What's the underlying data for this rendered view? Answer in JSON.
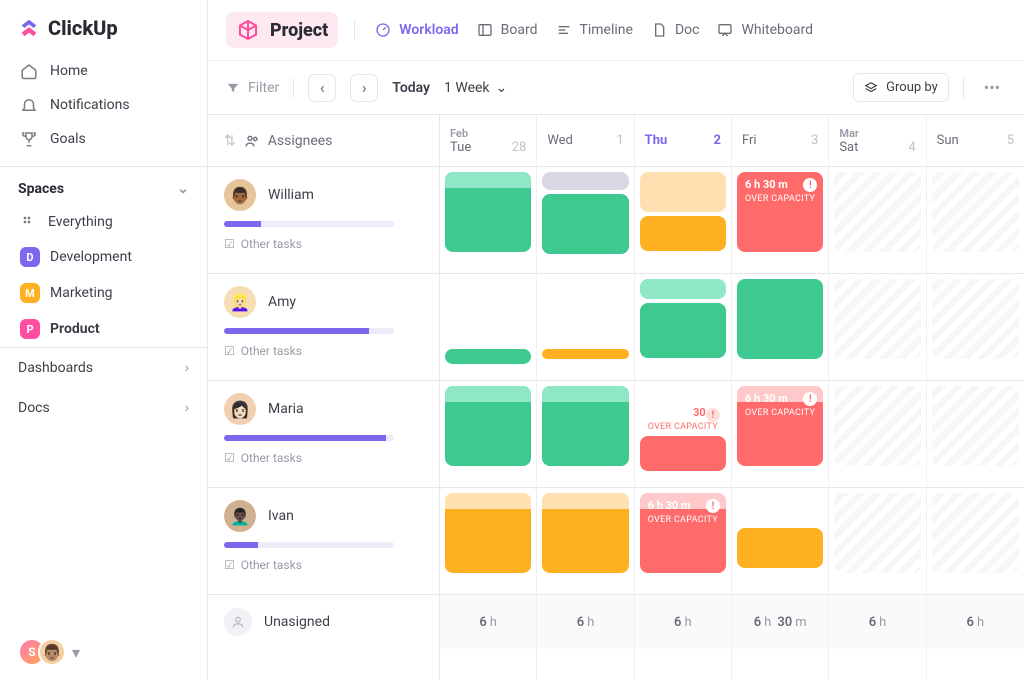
{
  "brand": "ClickUp",
  "nav": {
    "home": "Home",
    "notifications": "Notifications",
    "goals": "Goals"
  },
  "sidebar": {
    "spaces_label": "Spaces",
    "everything": "Everything",
    "items": [
      {
        "letter": "D",
        "label": "Development",
        "color": "#7b68ee"
      },
      {
        "letter": "M",
        "label": "Marketing",
        "color": "#ffb020"
      },
      {
        "letter": "P",
        "label": "Product",
        "color": "#ff4ea0"
      }
    ],
    "dashboards": "Dashboards",
    "docs": "Docs"
  },
  "header": {
    "project_label": "Project",
    "views": [
      "Workload",
      "Board",
      "Timeline",
      "Doc",
      "Whiteboard"
    ]
  },
  "toolbar": {
    "filter": "Filter",
    "today": "Today",
    "range": "1 Week",
    "group": "Group by"
  },
  "assignees_label": "Assignees",
  "other_tasks": "Other tasks",
  "unassigned": "Unasigned",
  "over_capacity": "OVER CAPACITY",
  "days": [
    {
      "month": "Feb",
      "name": "Tue",
      "num": "28"
    },
    {
      "month": "",
      "name": "Wed",
      "num": "1"
    },
    {
      "month": "",
      "name": "Thu",
      "num": "2",
      "today": true
    },
    {
      "month": "",
      "name": "Fri",
      "num": "3"
    },
    {
      "month": "Mar",
      "name": "Sat",
      "num": "4",
      "weekend": true
    },
    {
      "month": "",
      "name": "Sun",
      "num": "5",
      "weekend": true
    }
  ],
  "people": [
    {
      "name": "William",
      "progress": 22,
      "emoji": "👨🏾"
    },
    {
      "name": "Amy",
      "progress": 85,
      "emoji": "👱🏻‍♀️"
    },
    {
      "name": "Maria",
      "progress": 95,
      "emoji": "👩🏻"
    },
    {
      "name": "Ivan",
      "progress": 20,
      "emoji": "👨🏿‍🦱"
    }
  ],
  "capacity": {
    "william_fri": "6 h 30 m",
    "maria_thu": "30 m",
    "maria_fri": "6 h 30 m",
    "ivan_thu": "6 h 30 m"
  },
  "footer": [
    "6 h",
    "6 h",
    "6 h",
    "6 h 30 m",
    "6 h",
    "6 h"
  ]
}
